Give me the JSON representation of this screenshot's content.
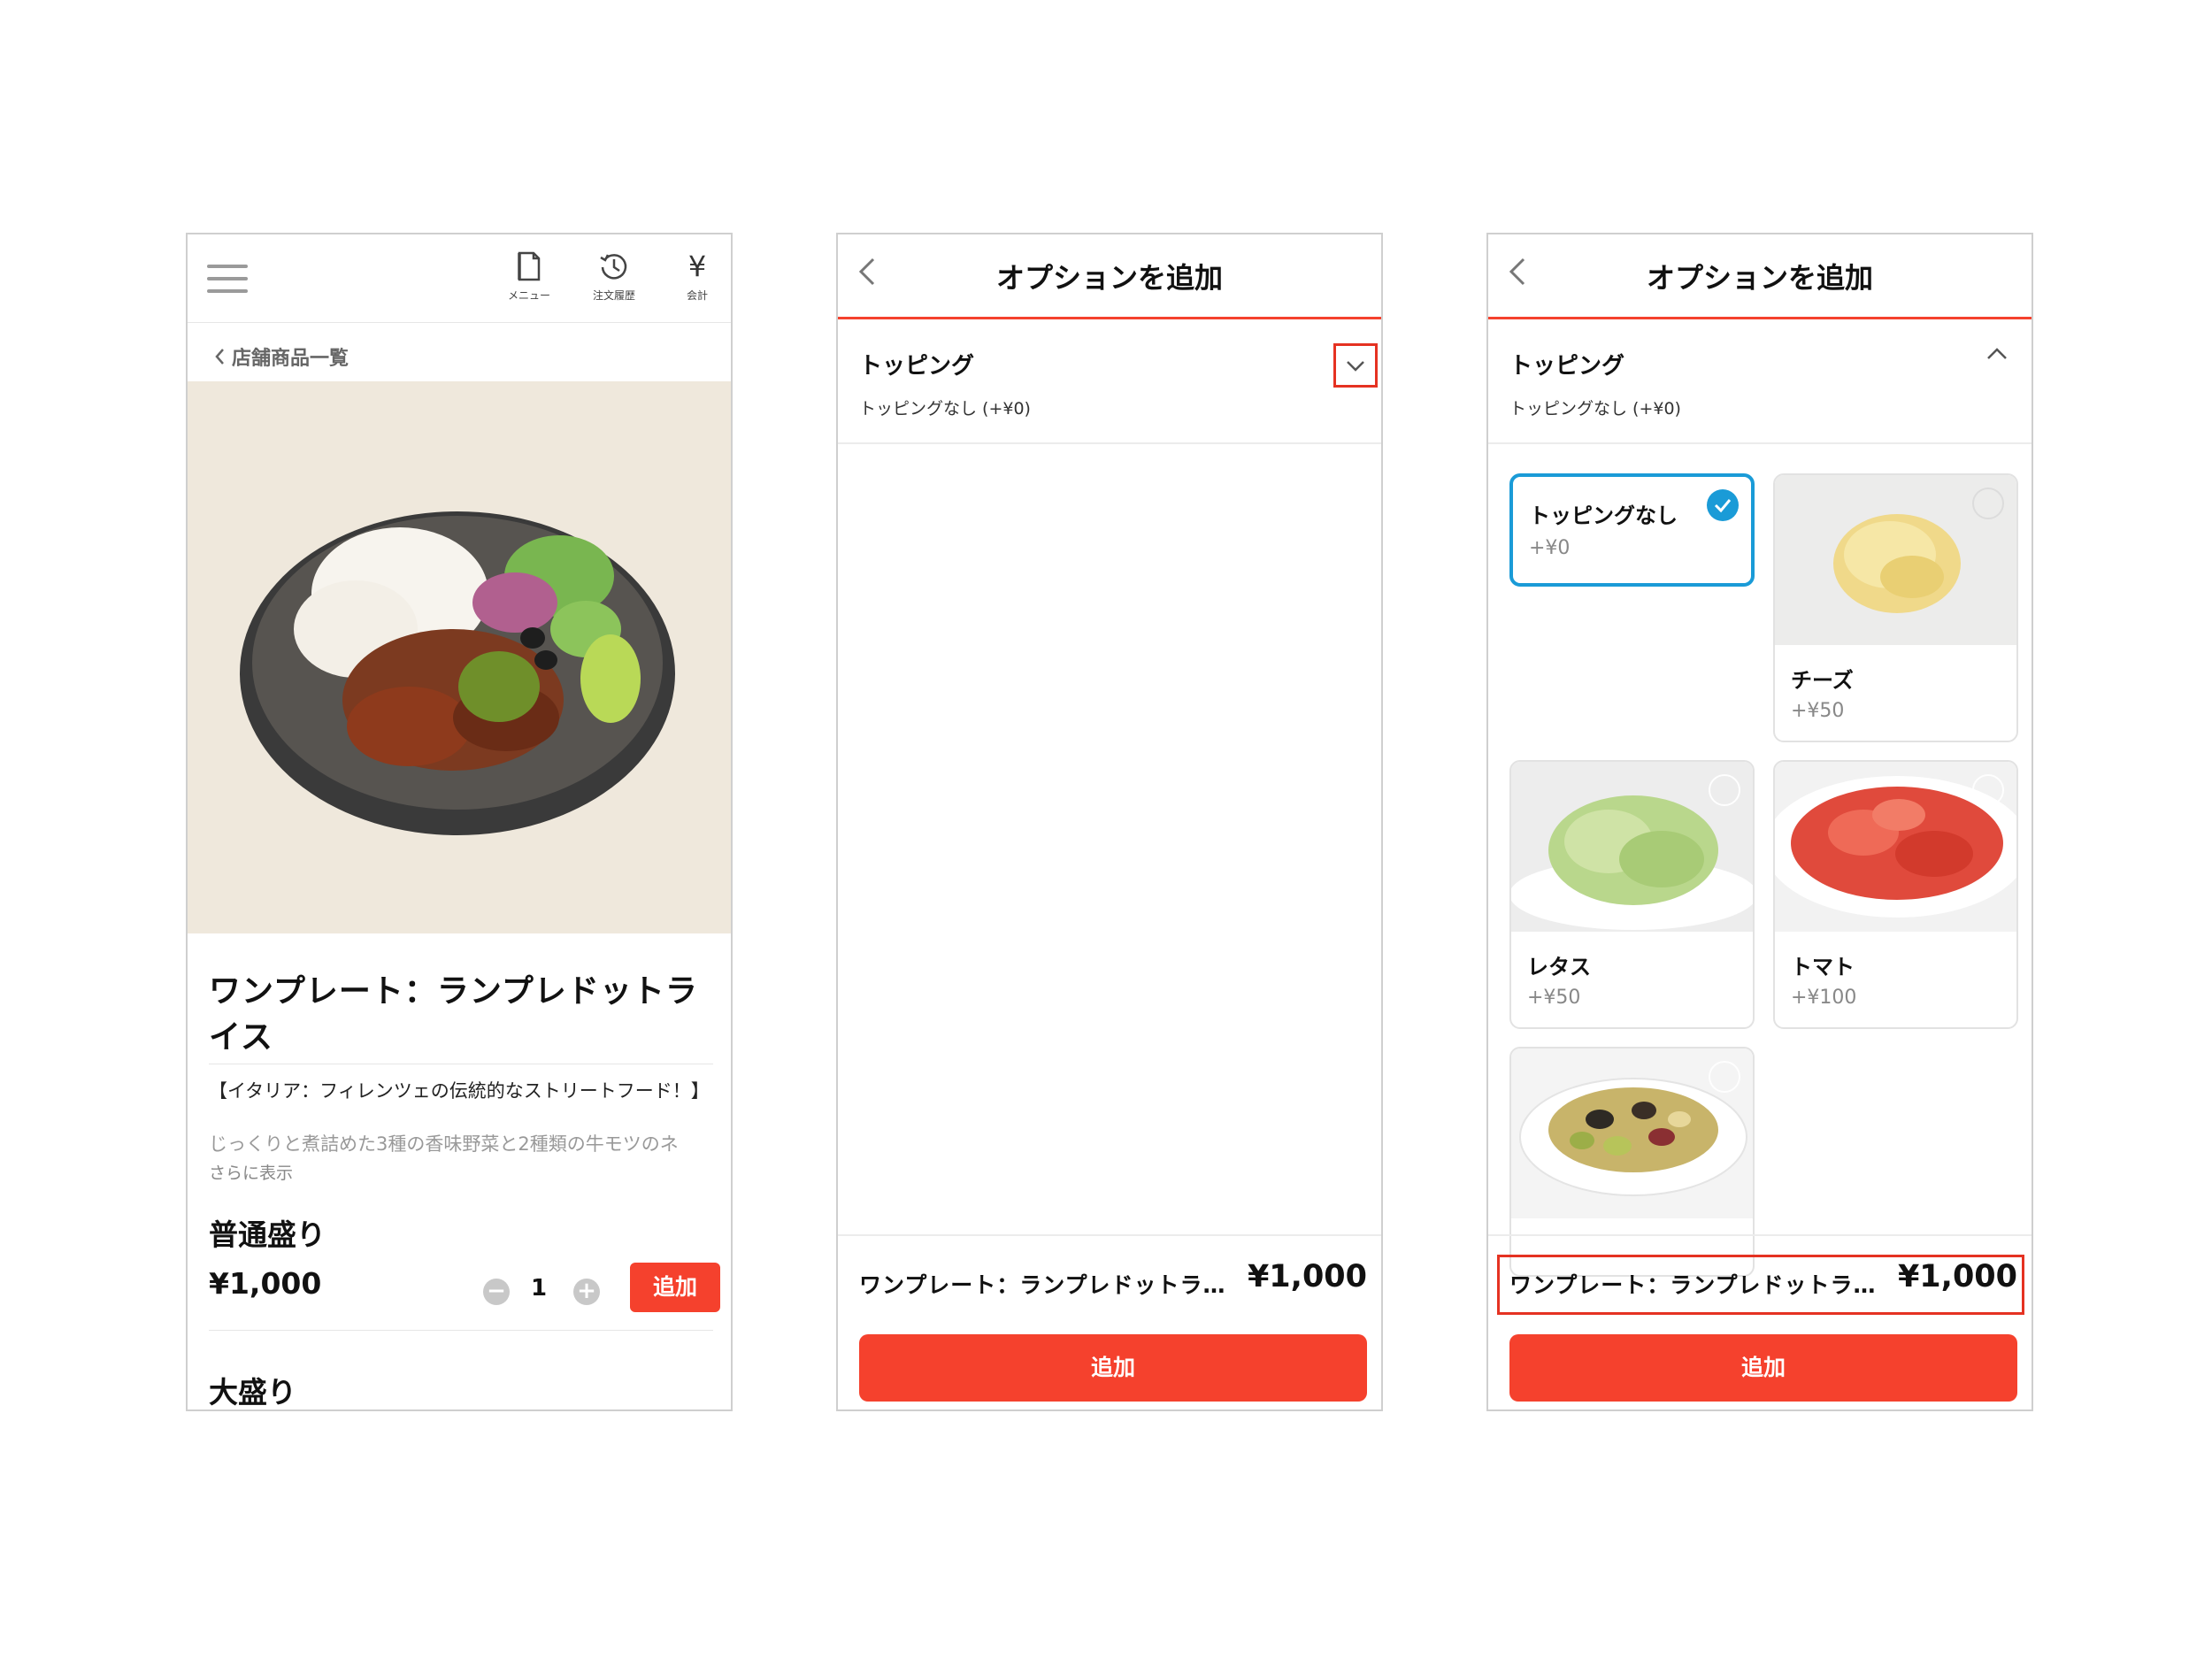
{
  "screen1": {
    "nav": {
      "menu_label": "メニュー",
      "history_label": "注文履歴",
      "checkout_label": "会計",
      "yen_glyph": "¥"
    },
    "breadcrumb": "店舗商品一覧",
    "product_title": "ワンプレート：ランプレドットライス",
    "description_line1": "【イタリア：フィレンツェの伝統的なストリートフード！】",
    "description_line2": "じっくりと煮詰めた3種の香味野菜と2種類の牛モツのネ",
    "show_more": "さらに表示",
    "size_regular": "普通盛り",
    "price": "¥1,000",
    "quantity": "1",
    "add_label": "追加",
    "size_large": "大盛り"
  },
  "options_screen": {
    "title": "オプションを追加",
    "section_title": "トッピング",
    "section_subtitle": "トッピングなし (+¥0)",
    "footer_name": "ワンプレート：ランプレドットラ…",
    "footer_price": "¥1,000",
    "add_label": "追加"
  },
  "toppings": [
    {
      "name": "トッピングなし",
      "price": "+¥0",
      "selected": true
    },
    {
      "name": "チーズ",
      "price": "+¥50",
      "selected": false
    },
    {
      "name": "レタス",
      "price": "+¥50",
      "selected": false
    },
    {
      "name": "トマト",
      "price": "+¥100",
      "selected": false
    },
    {
      "name": "",
      "price": "",
      "selected": false
    }
  ],
  "colors": {
    "accent": "#f5412d",
    "highlight_border": "#e53222",
    "selected_blue": "#1a9bd7",
    "hero_bg": "#efe8dc"
  }
}
